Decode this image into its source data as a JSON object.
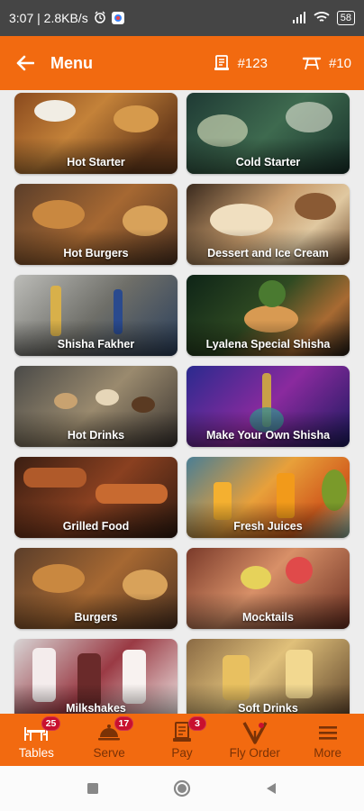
{
  "status_bar": {
    "left_text": "3:07 | 2.8KB/s",
    "battery": "58"
  },
  "app_bar": {
    "title": "Menu",
    "order_number": "#123",
    "table_number": "#10"
  },
  "categories": [
    {
      "label": "Hot Starter"
    },
    {
      "label": "Cold Starter"
    },
    {
      "label": "Hot Burgers"
    },
    {
      "label": "Dessert and Ice Cream"
    },
    {
      "label": "Shisha Fakher"
    },
    {
      "label": "Lyalena Special Shisha"
    },
    {
      "label": "Hot Drinks"
    },
    {
      "label": "Make Your Own Shisha"
    },
    {
      "label": "Grilled Food"
    },
    {
      "label": "Fresh Juices"
    },
    {
      "label": "Burgers"
    },
    {
      "label": "Mocktails"
    },
    {
      "label": "Milkshakes"
    },
    {
      "label": "Soft Drinks"
    }
  ],
  "bottom_nav": {
    "items": [
      {
        "label": "Tables",
        "badge": "25",
        "icon": "tables-icon"
      },
      {
        "label": "Serve",
        "badge": "17",
        "icon": "cloche-icon"
      },
      {
        "label": "Pay",
        "badge": "3",
        "icon": "receipt-icon"
      },
      {
        "label": "Fly Order",
        "icon": "fly-order-icon"
      },
      {
        "label": "More",
        "icon": "menu-icon"
      }
    ]
  },
  "colors": {
    "primary": "#f26a10",
    "inactive_nav": "#7a3206",
    "badge": "#c8102e",
    "status_bar": "#454545"
  }
}
